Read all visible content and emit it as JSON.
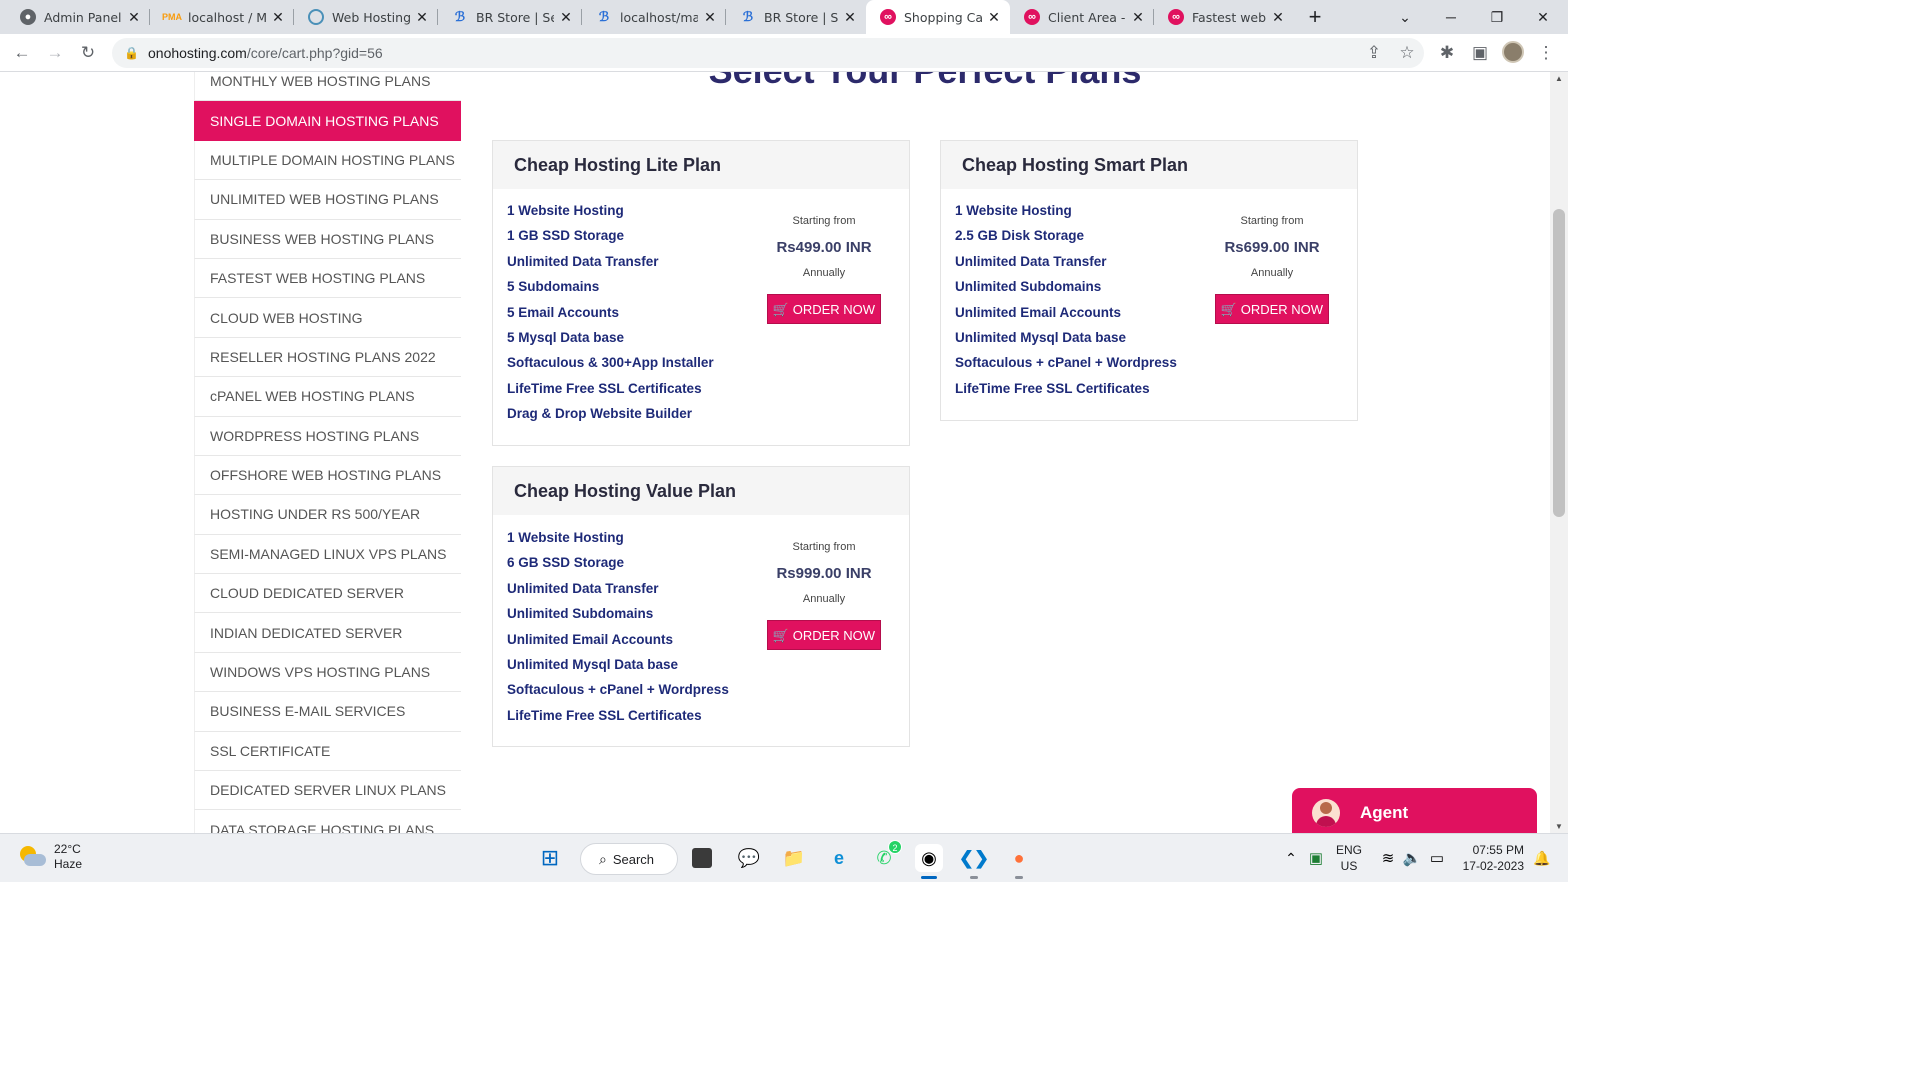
{
  "browser": {
    "tabs": [
      {
        "title": "Admin Panel |",
        "icon": "github-icon"
      },
      {
        "title": "localhost / My",
        "icon": "phpmyadmin-icon"
      },
      {
        "title": "Web Hosting",
        "icon": "webhosting-icon"
      },
      {
        "title": "BR Store | Selli",
        "icon": "brstore-icon"
      },
      {
        "title": "localhost/man",
        "icon": "brstore-icon"
      },
      {
        "title": "BR Store | Selli",
        "icon": "brstore-icon"
      },
      {
        "title": "Shopping Cart",
        "icon": "onohosting-icon"
      },
      {
        "title": "Client Area - C",
        "icon": "onohosting-icon"
      },
      {
        "title": "Fastest web h",
        "icon": "onohosting-icon"
      }
    ],
    "url_main": "onohosting.com",
    "url_rest": "/core/cart.php?gid=56"
  },
  "sidebar": {
    "items": [
      "MONTHLY WEB HOSTING PLANS",
      "SINGLE DOMAIN HOSTING PLANS",
      "MULTIPLE DOMAIN HOSTING PLANS",
      "UNLIMITED WEB HOSTING PLANS",
      "BUSINESS WEB HOSTING PLANS",
      "FASTEST WEB HOSTING PLANS",
      "CLOUD WEB HOSTING",
      "RESELLER HOSTING PLANS 2022",
      "cPANEL WEB HOSTING PLANS",
      "WORDPRESS HOSTING PLANS",
      "OFFSHORE WEB HOSTING PLANS",
      "HOSTING UNDER RS 500/YEAR",
      "SEMI-MANAGED LINUX VPS PLANS",
      "CLOUD DEDICATED SERVER",
      "INDIAN DEDICATED SERVER",
      "WINDOWS VPS HOSTING PLANS",
      "BUSINESS E-MAIL SERVICES",
      "SSL CERTIFICATE",
      "DEDICATED SERVER LINUX PLANS",
      "DATA STORAGE HOSTING PLANS"
    ],
    "active_index": 1
  },
  "page": {
    "heading": "Select Your Perfect Plans"
  },
  "plans": [
    {
      "name": "Cheap Hosting Lite Plan",
      "features": [
        "1 Website Hosting",
        "1 GB SSD Storage",
        "Unlimited Data Transfer",
        "5 Subdomains",
        "5 Email Accounts",
        "5 Mysql Data base",
        "Softaculous & 300+App Installer",
        "LifeTime Free SSL Certificates",
        "Drag & Drop Website Builder"
      ],
      "starting_label": "Starting from",
      "price": "Rs499.00 INR",
      "cycle": "Annually",
      "order_label": "ORDER NOW"
    },
    {
      "name": "Cheap Hosting Smart Plan",
      "features": [
        "1 Website Hosting",
        "2.5 GB Disk Storage",
        "Unlimited Data Transfer",
        "Unlimited Subdomains",
        "Unlimited Email Accounts",
        "Unlimited Mysql Data base",
        "Softaculous + cPanel + Wordpress",
        "LifeTime Free SSL Certificates"
      ],
      "starting_label": "Starting from",
      "price": "Rs699.00 INR",
      "cycle": "Annually",
      "order_label": "ORDER NOW"
    },
    {
      "name": "Cheap Hosting Value Plan",
      "features": [
        "1 Website Hosting",
        "6 GB SSD Storage",
        "Unlimited Data Transfer",
        "Unlimited Subdomains",
        "Unlimited Email Accounts",
        "Unlimited Mysql Data base",
        "Softaculous + cPanel + Wordpress",
        "LifeTime Free SSL Certificates"
      ],
      "starting_label": "Starting from",
      "price": "Rs999.00 INR",
      "cycle": "Annually",
      "order_label": "ORDER NOW"
    }
  ],
  "chat": {
    "label": "Agent"
  },
  "taskbar": {
    "weather_temp": "22°C",
    "weather_desc": "Haze",
    "search_label": "Search",
    "whatsapp_badge": "2",
    "lang_top": "ENG",
    "lang_bottom": "US",
    "time": "07:55 PM",
    "date": "17-02-2023"
  },
  "colors": {
    "accent": "#e0115f",
    "feature_text": "#1e2a78",
    "heading": "#2c2a6b"
  }
}
